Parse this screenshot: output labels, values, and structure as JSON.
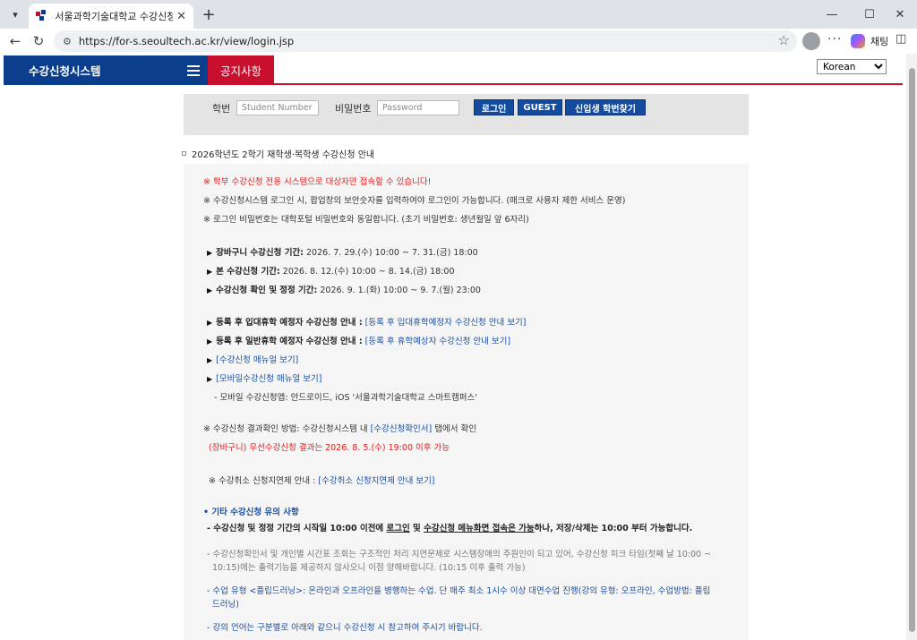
{
  "browser": {
    "tab_title": "서울과학기술대학교 수강신청시스",
    "url": "https://for-s.seoultech.ac.kr/view/login.jsp",
    "chat_label": "채팅"
  },
  "header": {
    "brand": "수강신청시스템",
    "notice_tab": "공지사항",
    "language": "Korean"
  },
  "login": {
    "id_label": "학번",
    "id_placeholder": "Student Number",
    "pw_label": "비밀번호",
    "pw_placeholder": "Password",
    "login_button": "로그인",
    "guest_button": "GUEST",
    "find_button": "신입생 학번찾기"
  },
  "notice": {
    "heading": "2026학년도 2학기 재학생·복학생 수강신청 안내",
    "warn1": "※ 학부 수강신청 전용 시스템으로 대상자만 접속할 수 있습니다!",
    "warn2": "※ 수강신청시스템 로그인 시, 팝업창의 보안숫자를 입력하여야 로그인이 가능합니다. (매크로 사용자 제한 서비스 운영)",
    "warn3": "※ 로그인 비밀번호는 대학포털 비밀번호와 동일합니다. (초기 비밀번호: 생년월일 앞 6자리)",
    "p1_label": "장바구니 수강신청 기간:",
    "p1_value": "2026. 7. 29.(수) 10:00 ~ 7. 31.(금) 18:00",
    "p2_label": "본 수강신청 기간:",
    "p2_value": "2026. 8. 12.(수) 10:00 ~ 8. 14.(금) 18:00",
    "p3_label": "수강신청 확인 및 정정 기간:",
    "p3_value": "2026. 9. 1.(화) 10:00 ~ 9. 7.(월) 23:00",
    "g1_label": "등록 후 입대휴학 예정자 수강신청 안내 :",
    "g1_link": "[등록 후 입대휴학예정자 수강신청 안내 보기]",
    "g2_label": "등록 후 일반휴학 예정자 수강신청 안내 :",
    "g2_link": "[등록 후 휴학예상자 수강신청 안내 보기]",
    "manual_link": "[수강신청 매뉴얼 보기]",
    "mobile_manual_link": "[모바일수강신청 매뉴얼 보기]",
    "mobile_app": "- 모바일 수강신청앱: 안드로이드, iOS '서울과학기술대학교 스마트캠퍼스'",
    "result_pre": "※ 수강신청 결과확인 방법: 수강신청시스템 내",
    "result_link": "[수강신청확인서]",
    "result_post": "탭에서 확인",
    "cart_result": "(장바구니) 우선수강신청 결과는 2026. 8. 5.(수) 19:00 이후 가능",
    "cancel_label": "※ 수강취소 신청지연제 안내 :",
    "cancel_link": "[수강취소 신청지연제 안내 보기]",
    "etc_heading": "• 기타 수강신청 유의 사항",
    "etc1_a": "- 수강신청 및 정정 기간의 시작일 10:00 이전에",
    "etc1_b": "로그인",
    "etc1_c": "및",
    "etc1_d": "수강신청 메뉴화면 접속은 가능",
    "etc1_e": "하나, 저장/삭제는 10:00 부터 가능합니다.",
    "etc2_line1": "- 수강신청확인서 및 개인별 시간표 조회는 구조적인 처리 지연문제로 시스템장애의 주원인이 되고 있어, 수강신청 피크 타임(첫째 날 10:00 ~",
    "etc2_line2": "10:15)에는 출력기능을 제공하지 않사오니 이점 양해바랍니다. (10:15 이후 출력 가능)",
    "etc3_line1": "- 수업 유형 <플립드러닝>: 온라인과 오프라인을 병행하는 수업. 단 매주 최소 1시수 이상 대면수업 진행(강의 유형: 오프라인, 수업방법: 플립",
    "etc3_line2": "드러닝)",
    "etc4": "- 강의 언어는 구분별로 아래와 같으니 수강신청 시 참고하여 주시기 바랍니다."
  }
}
